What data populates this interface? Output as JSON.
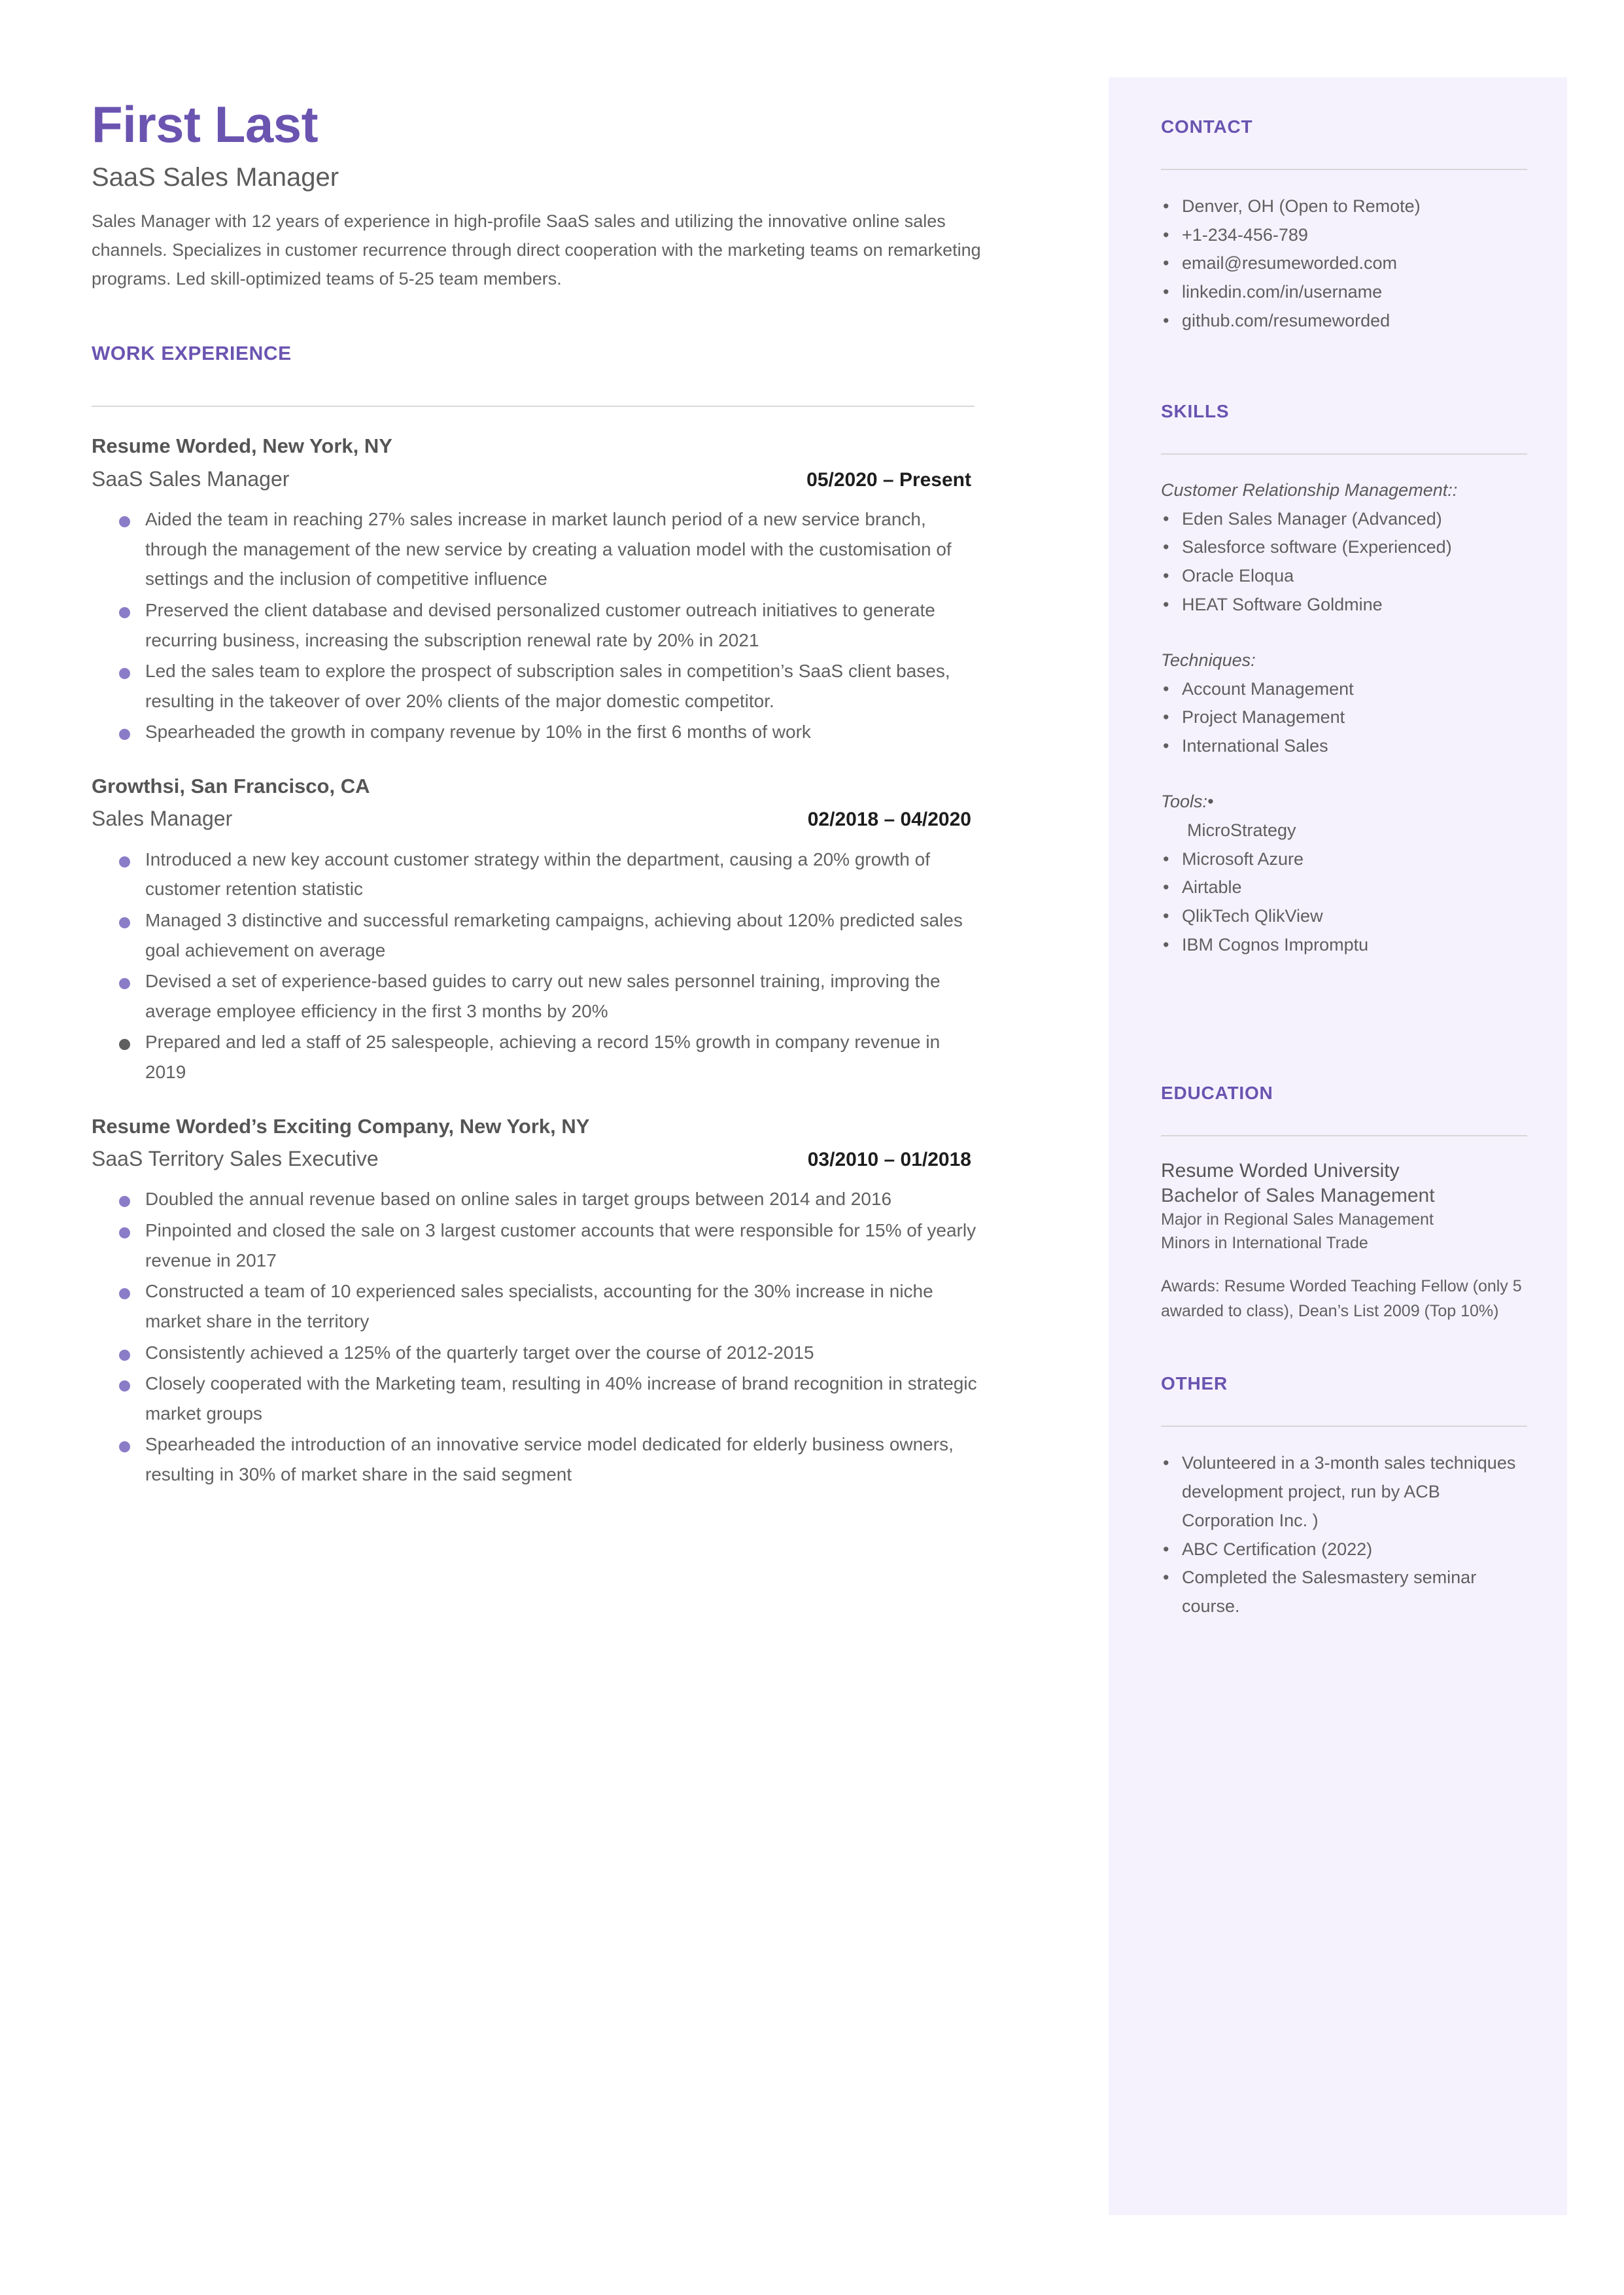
{
  "colors": {
    "accent_purple": "#6a54b0",
    "bullet_purple": "#8b7cc8",
    "sidebar_bg": "#f5f2fe",
    "body_text": "#5f5f5f"
  },
  "header": {
    "name": "First Last",
    "title": "SaaS Sales Manager",
    "summary": "Sales Manager with 12 years of experience in high-profile SaaS sales and utilizing the innovative online sales channels. Specializes in customer recurrence through direct cooperation with the marketing teams on remarketing programs.  Led skill-optimized teams of 5-25 team members."
  },
  "work": {
    "heading": "WORK EXPERIENCE",
    "jobs": [
      {
        "company": "Resume Worded, New York, NY",
        "role": "SaaS Sales Manager",
        "dates": "05/2020 – Present",
        "bullets": [
          "Aided the team in reaching 27% sales increase in market launch period of a new service branch, through the management of the new service by creating a valuation model with the customisation of settings and the inclusion of competitive influence",
          "Preserved the client database and devised personalized customer outreach initiatives to generate recurring business, increasing the subscription renewal rate by 20% in 2021",
          "Led the sales team to explore the prospect of subscription sales in competition’s SaaS client bases, resulting in the takeover of over 20% clients of the major domestic competitor.",
          "Spearheaded the growth in company revenue by 10% in the first 6 months of work"
        ]
      },
      {
        "company": "Growthsi, San Francisco, CA",
        "role": "Sales Manager",
        "dates": "02/2018 – 04/2020",
        "bullets": [
          "Introduced a new key account customer strategy within the department, causing a 20% growth of customer retention statistic",
          "Managed 3 distinctive and successful remarketing campaigns, achieving about 120% predicted sales goal achievement on average",
          "Devised a set of experience-based guides to carry out new sales personnel training, improving the average employee efficiency in the first 3 months by 20%",
          "Prepared and led a staff of 25 salespeople, achieving a record 15% growth in company revenue in 2019"
        ]
      },
      {
        "company": "Resume Worded’s Exciting Company, New York, NY",
        "role": "SaaS Territory Sales Executive",
        "dates": "03/2010 – 01/2018",
        "bullets": [
          "Doubled the annual revenue based on online sales in target groups between 2014 and 2016",
          "Pinpointed and closed the sale on 3 largest customer accounts that were responsible for 15% of yearly revenue in 2017",
          "Constructed a team of 10 experienced sales specialists, accounting for the 30% increase in niche market share in the territory",
          "Consistently achieved a 125% of the quarterly target over the course of 2012-2015",
          "Closely cooperated with the Marketing team, resulting in 40% increase of brand recognition in strategic market groups",
          "Spearheaded the introduction of an innovative service model dedicated for elderly business owners, resulting in 30% of market share in the said segment"
        ]
      }
    ]
  },
  "contact": {
    "heading": "CONTACT",
    "items": [
      " Denver, OH (Open to Remote)",
      "+1-234-456-789",
      "email@resumeworded.com",
      "linkedin.com/in/username",
      "github.com/resumeworded"
    ]
  },
  "skills": {
    "heading": "SKILLS",
    "groups": [
      {
        "label": "Customer Relationship Management::",
        "items": [
          " Eden Sales Manager (Advanced)",
          " Salesforce software (Experienced)",
          "Oracle Eloqua",
          "HEAT Software Goldmine"
        ]
      },
      {
        "label": "Techniques:",
        "items": [
          " Account Management",
          " Project Management",
          " International Sales"
        ]
      },
      {
        "label": "Tools:•",
        "items": [
          "MicroStrategy",
          "Microsoft Azure",
          "Airtable",
          "QlikTech QlikView",
          "IBM Cognos Impromptu"
        ]
      }
    ]
  },
  "education": {
    "heading": "EDUCATION",
    "school": "Resume Worded University",
    "degree": "Bachelor of Sales Management",
    "major": "Major in Regional Sales Management",
    "minor": "Minors in International Trade",
    "awards": "Awards: Resume Worded Teaching Fellow (only 5 awarded to class), Dean’s List 2009 (Top 10%)"
  },
  "other": {
    "heading": "OTHER",
    "items": [
      " Volunteered in a 3-month sales techniques development project, run by ACB Corporation Inc. )",
      " ABC Certification (2022)",
      " Completed the Salesmastery seminar course."
    ]
  }
}
